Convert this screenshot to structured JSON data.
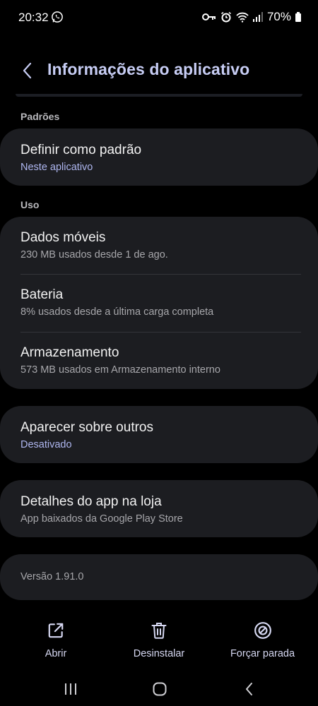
{
  "status": {
    "time": "20:32",
    "battery": "70%",
    "icons": [
      "whatsapp-icon",
      "key-icon",
      "alarm-icon",
      "wifi-icon",
      "signal-icon",
      "battery-icon"
    ]
  },
  "header": {
    "title": "Informações do aplicativo"
  },
  "sections": {
    "defaults_label": "Padrões",
    "usage_label": "Uso"
  },
  "defaults": {
    "title": "Definir como padrão",
    "subtitle": "Neste aplicativo"
  },
  "usage": {
    "mobile_data": {
      "title": "Dados móveis",
      "subtitle": "230 MB usados desde 1 de ago."
    },
    "battery": {
      "title": "Bateria",
      "subtitle": "8% usados desde a última carga completa"
    },
    "storage": {
      "title": "Armazenamento",
      "subtitle": "573 MB usados em Armazenamento interno"
    }
  },
  "overlay": {
    "title": "Aparecer sobre outros",
    "subtitle": "Desativado"
  },
  "store": {
    "title": "Detalhes do app na loja",
    "subtitle": "App baixados da Google Play Store"
  },
  "version": "Versão 1.91.0",
  "actions": {
    "open": "Abrir",
    "uninstall": "Desinstalar",
    "force_stop": "Forçar parada"
  },
  "colors": {
    "background": "#000000",
    "card": "#1c1d21",
    "accent": "#aeb6ef",
    "title": "#c7cdf4"
  }
}
